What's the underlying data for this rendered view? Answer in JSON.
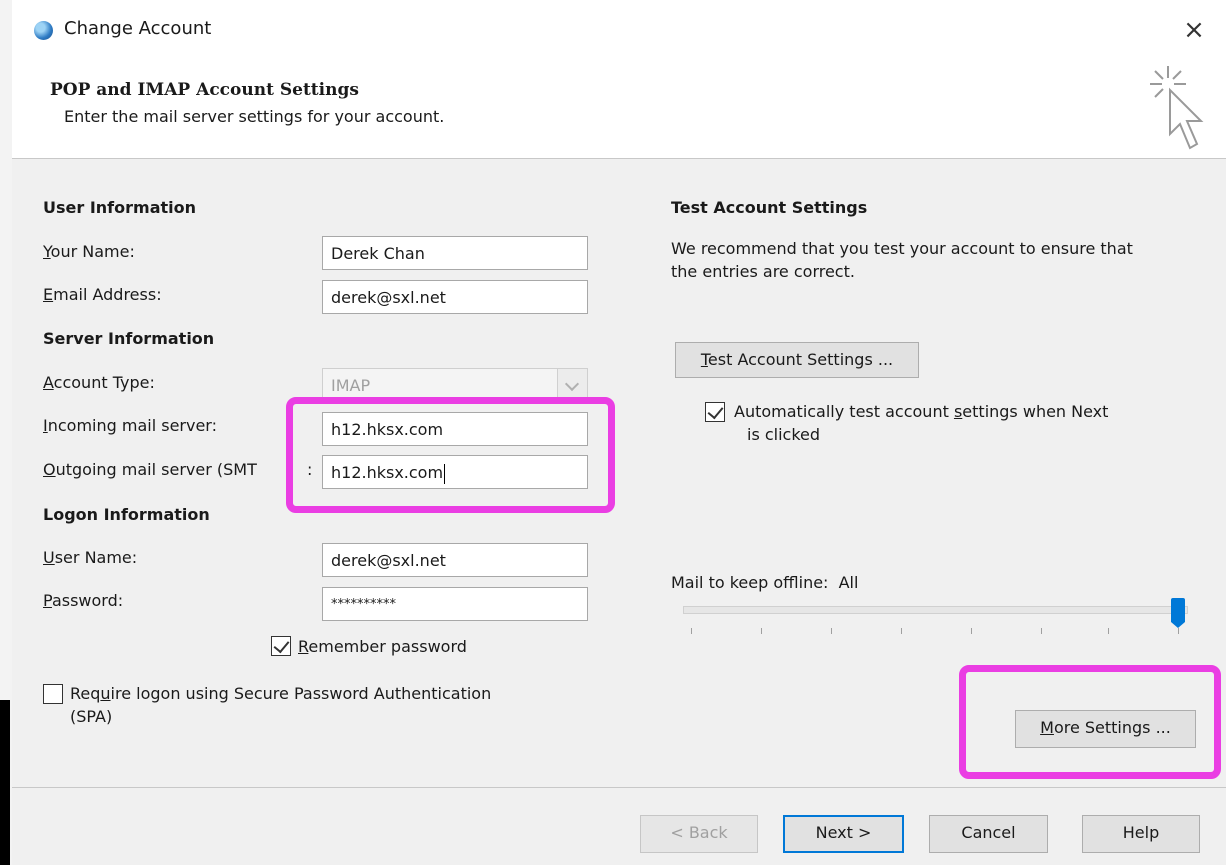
{
  "window": {
    "title": "Change Account",
    "close_glyph": "×"
  },
  "header": {
    "title": "POP and IMAP Account Settings",
    "subtitle": "Enter the mail server settings for your account.",
    "icon": "wizard-cursor-icon"
  },
  "user_info": {
    "heading": "User Information",
    "name_label_key": "Y",
    "name_label_rest": "our Name:",
    "name_value": "Derek Chan",
    "email_label_key": "E",
    "email_label_rest": "mail Address:",
    "email_value": "derek@sxl.net"
  },
  "server_info": {
    "heading": "Server Information",
    "account_type_label_key": "A",
    "account_type_label_rest": "ccount Type:",
    "account_type_value": "IMAP",
    "incoming_label_key": "I",
    "incoming_label_rest": "ncoming mail server:",
    "incoming_value": "h12.hksx.com",
    "outgoing_label_key": "O",
    "outgoing_label_rest": "utgoing mail server (SMT",
    "outgoing_label_tail": ":",
    "outgoing_value": "h12.hksx.com"
  },
  "logon_info": {
    "heading": "Logon Information",
    "username_label_key": "U",
    "username_label_rest": "ser Name:",
    "username_value": "derek@sxl.net",
    "password_label_key": "P",
    "password_label_rest": "assword:",
    "password_value": "**********",
    "remember_key": "R",
    "remember_rest": "emember password",
    "remember_checked": true,
    "spa_label_pre": "Req",
    "spa_label_key": "u",
    "spa_label_post": "ire logon using Secure Password Authentication",
    "spa_label_line2": "(SPA)",
    "spa_checked": false
  },
  "test_settings": {
    "heading": "Test Account Settings",
    "description_line1": "We recommend that you test your account to ensure that",
    "description_line2": "the entries are correct.",
    "button_key": "T",
    "button_rest": "est Account Settings ...",
    "auto_test_pre": "Automatically test account ",
    "auto_test_key": "s",
    "auto_test_post": "ettings when Next",
    "auto_test_line2": "is clicked",
    "auto_test_checked": true
  },
  "offline": {
    "label": "Mail to keep offline:",
    "value": "All",
    "slider_fraction": 1.0
  },
  "more_settings": {
    "key": "M",
    "rest": "ore Settings ..."
  },
  "footer": {
    "back": "< Back",
    "next": "Next >",
    "cancel": "Cancel",
    "help": "Help"
  },
  "colors": {
    "highlight": "#ea3ee3",
    "accent": "#0078d7"
  }
}
